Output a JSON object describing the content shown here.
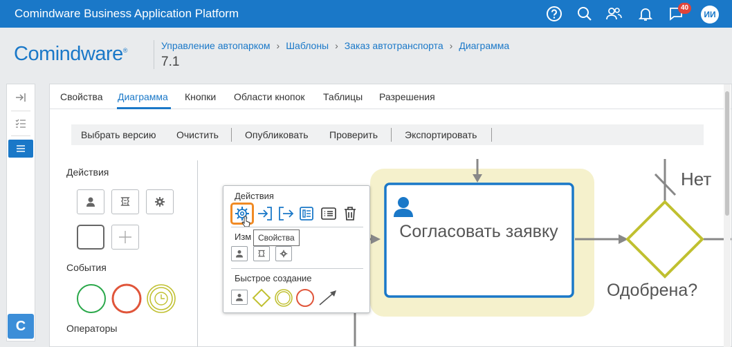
{
  "app": {
    "title": "Comindware Business Application Platform",
    "notifications_count": "40",
    "user_initials": "ИИ"
  },
  "colors": {
    "brand": "#1a78c8",
    "badge": "#e0443a",
    "task_border": "#1a78c8",
    "task_highlight": "#f5f1cc",
    "gateway": "#c0c030",
    "event_start": "#2aa84a",
    "event_intermediate": "#e0553a",
    "event_timer": "#c0c030",
    "highlight_orange": "#f08a24"
  },
  "header": {
    "logo": "Comindware",
    "logo_mark": "®",
    "breadcrumb": [
      "Управление автопарком",
      "Шаблоны",
      "Заказ автотранспорта",
      "Диаграмма"
    ],
    "version": "7.1"
  },
  "tabs": [
    {
      "label": "Свойства",
      "active": false
    },
    {
      "label": "Диаграмма",
      "active": true
    },
    {
      "label": "Кнопки",
      "active": false
    },
    {
      "label": "Области кнопок",
      "active": false
    },
    {
      "label": "Таблицы",
      "active": false
    },
    {
      "label": "Разрешения",
      "active": false
    }
  ],
  "toolbar": {
    "select_version": "Выбрать версию",
    "clear": "Очистить",
    "publish": "Опубликовать",
    "check": "Проверить",
    "export": "Экспортировать"
  },
  "palette": {
    "actions_label": "Действия",
    "events_label": "События",
    "operators_label": "Операторы"
  },
  "popup": {
    "actions_label": "Действия",
    "change_label": "Изм",
    "quick_create_label": "Быстрое создание",
    "tooltip": "Свойства"
  },
  "diagram": {
    "task_title": "Согласовать заявку",
    "gateway_label": "Одобрена?",
    "no_label": "Нет"
  },
  "icons": {
    "top": [
      "help-icon",
      "search-icon",
      "users-icon",
      "bell-icon",
      "chat-icon"
    ],
    "mini": [
      "collapse-icon",
      "checklist-icon",
      "menu-icon"
    ],
    "popup_actions": [
      "gear-icon",
      "enter-icon",
      "exit-icon",
      "form-icon",
      "list-icon",
      "trash-icon"
    ]
  }
}
